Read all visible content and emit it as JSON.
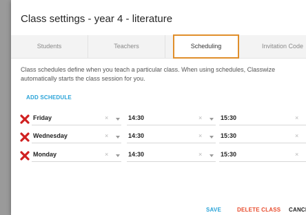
{
  "dialog": {
    "title": "Class settings - year 4 - literature"
  },
  "tabs": [
    {
      "label": "Students"
    },
    {
      "label": "Teachers"
    },
    {
      "label": "Scheduling",
      "active": true
    },
    {
      "label": "Invitation Code"
    }
  ],
  "description": "Class schedules define when you teach a particular class. When using schedules, Classwize automatically starts the class session for you.",
  "add_schedule_label": "ADD SCHEDULE",
  "schedules": [
    {
      "day": "Friday",
      "start": "14:30",
      "end": "15:30"
    },
    {
      "day": "Wednesday",
      "start": "14:30",
      "end": "15:30"
    },
    {
      "day": "Monday",
      "start": "14:30",
      "end": "15:30"
    }
  ],
  "clear_glyph": "×",
  "icons": {
    "delete": "delete-x-icon",
    "dropdown": "chevron-down-icon",
    "clear": "clear-icon"
  },
  "actions": {
    "save": "SAVE",
    "delete_class": "DELETE CLASS",
    "cancel": "CANCEL"
  },
  "colors": {
    "accent": "#29a3d8",
    "danger": "#e84b2c",
    "delete_icon": "#d02020",
    "tab_active_border": "#e08e2a"
  }
}
